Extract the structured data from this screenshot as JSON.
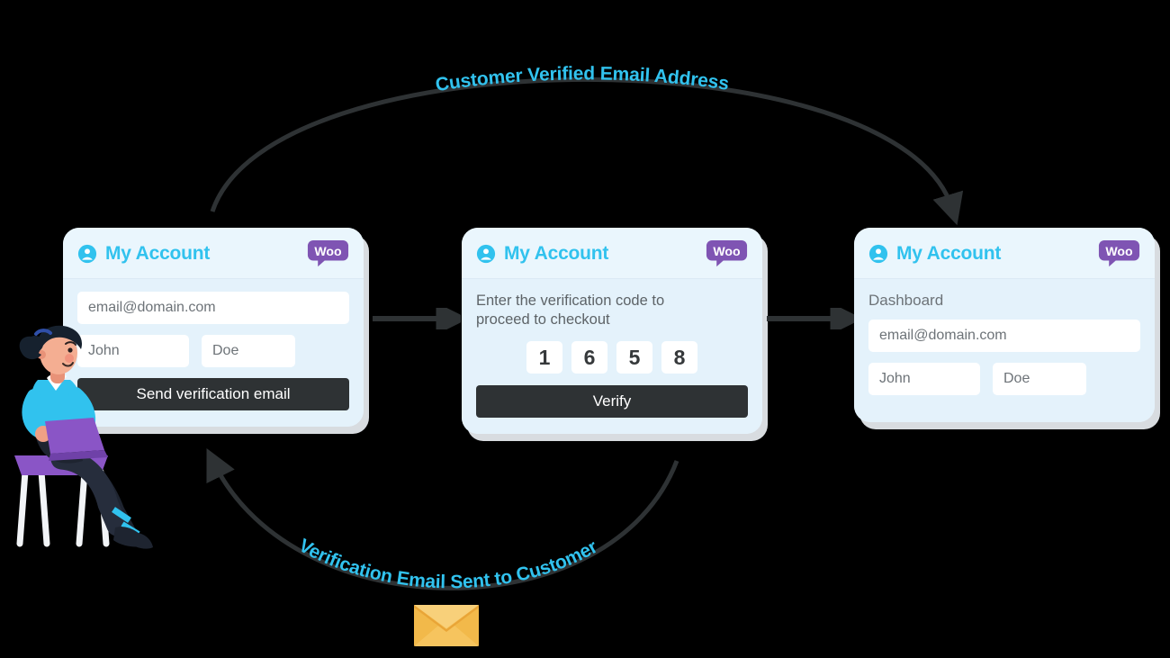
{
  "diagram": {
    "title": "WooCommerce email verification flow",
    "colors": {
      "accent_cyan": "#31c2ee",
      "card_bg": "#e4f2fb",
      "card_header_bg": "#eaf6fd",
      "button_dark": "#2e3234",
      "woo_purple": "#7f54b3",
      "arc_dark": "#2e3234",
      "envelope_orange": "#f6b33d"
    },
    "arcs": [
      {
        "name": "top-arc",
        "label": "Customer Verified Email Address",
        "direction": "left-to-right"
      },
      {
        "name": "bottom-arc",
        "label": "Verification Email Sent to Customer",
        "direction": "right-to-left"
      }
    ],
    "icons": {
      "user": "user-circle-icon",
      "brand": "woocommerce-logo",
      "mail": "envelope-icon",
      "person": "person-with-laptop-illustration"
    }
  },
  "cards": [
    {
      "id": "signup",
      "header_title": "My Account",
      "brand_label": "Woo",
      "email_value": "email@domain.com",
      "first_name_value": "John",
      "last_name_value": "Doe",
      "primary_button": "Send verification email"
    },
    {
      "id": "verify",
      "header_title": "My Account",
      "brand_label": "Woo",
      "prompt": "Enter the verification code to proceed to checkout",
      "code_digits": [
        "1",
        "6",
        "5",
        "8"
      ],
      "primary_button": "Verify"
    },
    {
      "id": "dashboard",
      "header_title": "My Account",
      "brand_label": "Woo",
      "section_label": "Dashboard",
      "email_value": "email@domain.com",
      "first_name_value": "John",
      "last_name_value": "Doe"
    }
  ]
}
